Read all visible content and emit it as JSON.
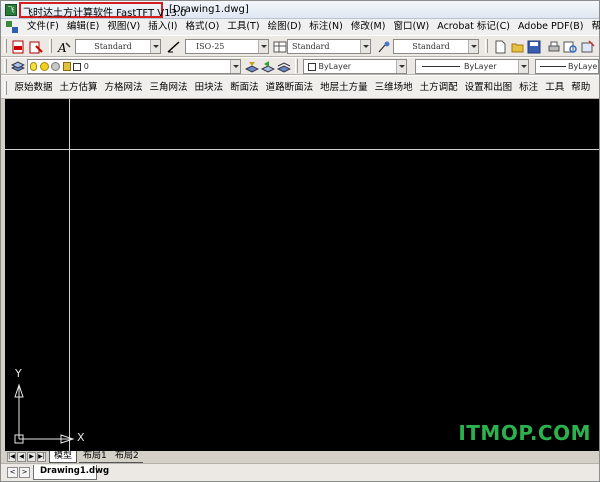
{
  "window": {
    "app_title": "飞时达土方计算软件 FastTFT V13.0",
    "document_title": "[Drawing1.dwg]"
  },
  "menu": {
    "items": [
      "文件(F)",
      "编辑(E)",
      "视图(V)",
      "插入(I)",
      "格式(O)",
      "工具(T)",
      "绘图(D)",
      "标注(N)",
      "修改(M)",
      "窗口(W)",
      "Acrobat 标记(C)",
      "Adobe PDF(B)",
      "帮助(H)"
    ]
  },
  "toolbar_styles": {
    "text_style": "Standard",
    "dim_style": "ISO-25",
    "table_style": "Standard",
    "multileader_style": "Standard"
  },
  "toolbar_layers": {
    "current_layer": "0",
    "color": "ByLayer",
    "linetype": "ByLayer",
    "lineweight": "ByLayer"
  },
  "command_bar": {
    "items": [
      "原始数据",
      "土方估算",
      "方格网法",
      "三角网法",
      "田块法",
      "断面法",
      "道路断面法",
      "地层土方量",
      "三维场地",
      "土方调配",
      "设置和出图",
      "标注",
      "工具",
      "帮助"
    ]
  },
  "canvas": {
    "ucs_y": "Y",
    "ucs_x": "X",
    "watermark": "ITMOP.COM",
    "background": "#000000",
    "crosshair_color": "#d0d0d0",
    "watermark_color": "#2bb24c"
  },
  "layout_tabs": {
    "nav": [
      "|◀",
      "◀",
      "▶",
      "▶|"
    ],
    "tabs": [
      "模型",
      "布局1",
      "布局2"
    ]
  },
  "document_tabs": {
    "nav_prev": "<",
    "nav_next": ">",
    "active": "Drawing1.dwg"
  },
  "colors": {
    "title_highlight": "#d42020"
  }
}
